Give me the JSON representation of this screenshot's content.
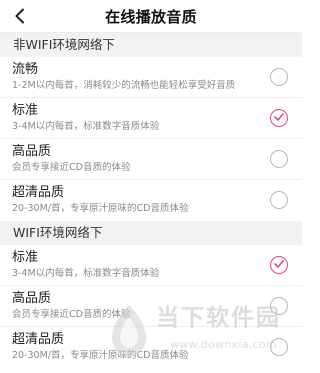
{
  "header": {
    "title": "在线播放音质",
    "back_icon": "chevron-left-icon"
  },
  "sections": [
    {
      "title": "非WIFI环境网络下",
      "options": [
        {
          "title": "流畅",
          "desc": "1-2M以内每首，消耗较少的流畅也能轻松享受好音质",
          "selected": false
        },
        {
          "title": "标准",
          "desc": "3-4M以内每首，标准数字音质体验",
          "selected": true
        },
        {
          "title": "高品质",
          "desc": "会员专享接近CD音质的体验",
          "selected": false
        },
        {
          "title": "超清品质",
          "desc": "20-30M/首，专享原汁原味的CD音质体验",
          "selected": false
        }
      ]
    },
    {
      "title": "WIFI环境网络下",
      "options": [
        {
          "title": "标准",
          "desc": "3-4M以内每首，标准数字音质体验",
          "selected": true
        },
        {
          "title": "高品质",
          "desc": "会员专享接近CD音质的体验",
          "selected": false
        },
        {
          "title": "超清品质",
          "desc": "20-30M/首，专享原汁原味的CD音质体验",
          "selected": false
        }
      ]
    }
  ],
  "watermark": {
    "title": "当下软件园",
    "url": "www.downxia.com"
  },
  "colors": {
    "accent": "#e0487e",
    "radio_border": "#b8b8b8",
    "section_bg": "#f2f2f2"
  }
}
